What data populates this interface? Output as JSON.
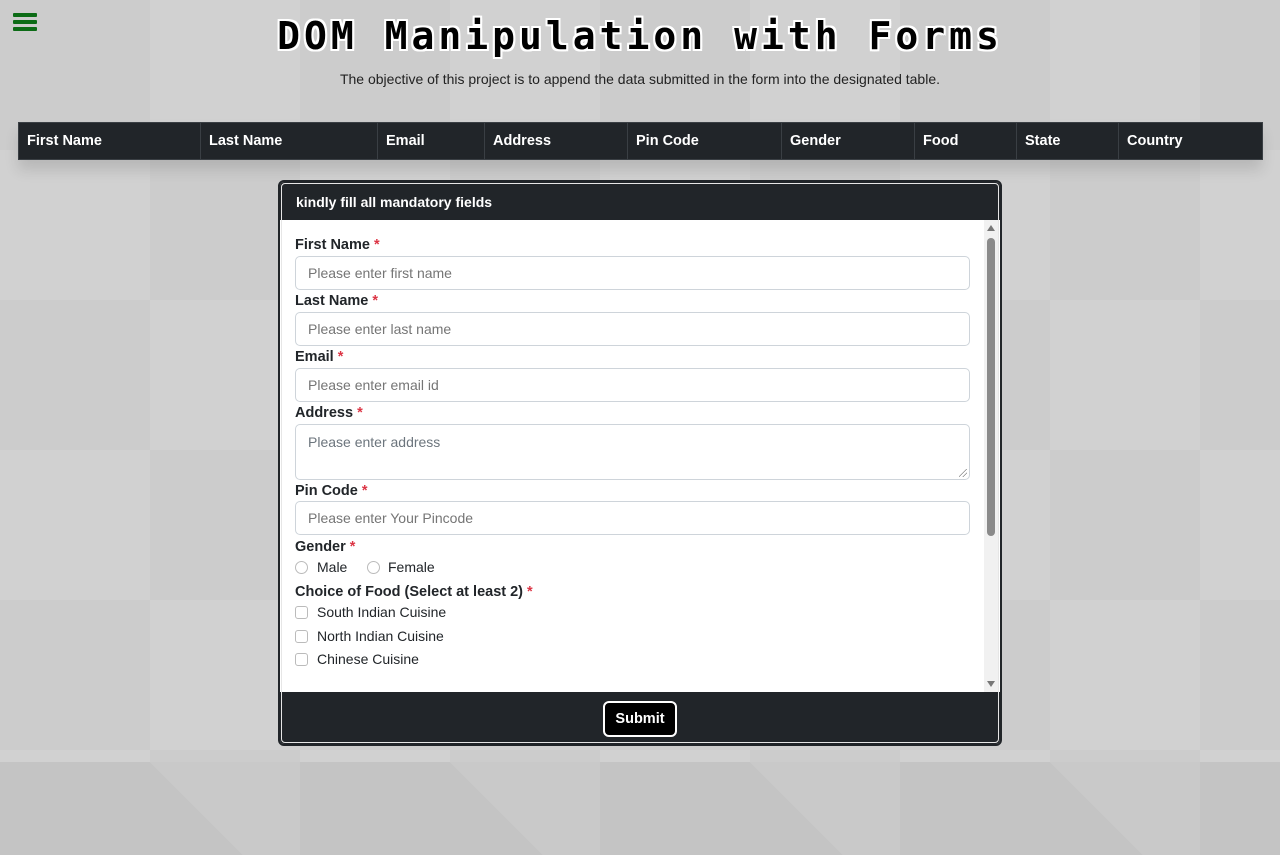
{
  "page": {
    "title": "DOM Manipulation with Forms",
    "subtitle": "The objective of this project is to append the data submitted in the form into the designated table."
  },
  "menu": {
    "icon": "hamburger-menu-icon",
    "color": "#0c6b16"
  },
  "table": {
    "columns": [
      "First Name",
      "Last Name",
      "Email",
      "Address",
      "Pin Code",
      "Gender",
      "Food",
      "State",
      "Country"
    ]
  },
  "form": {
    "header": "kindly fill all mandatory fields",
    "required_marker": "*",
    "first_name": {
      "label": "First Name",
      "placeholder": "Please enter first name"
    },
    "last_name": {
      "label": "Last Name",
      "placeholder": "Please enter last name"
    },
    "email": {
      "label": "Email",
      "placeholder": "Please enter email id"
    },
    "address": {
      "label": "Address",
      "placeholder": "Please enter address"
    },
    "pincode": {
      "label": "Pin Code",
      "placeholder": "Please enter Your Pincode"
    },
    "gender": {
      "label": "Gender",
      "options": [
        "Male",
        "Female"
      ]
    },
    "food": {
      "label": "Choice of Food (Select at least 2)",
      "options": [
        "South Indian Cuisine",
        "North Indian Cuisine",
        "Chinese Cuisine"
      ]
    },
    "submit_label": "Submit"
  },
  "colors": {
    "dark": "#212529",
    "required": "#dc3545"
  }
}
